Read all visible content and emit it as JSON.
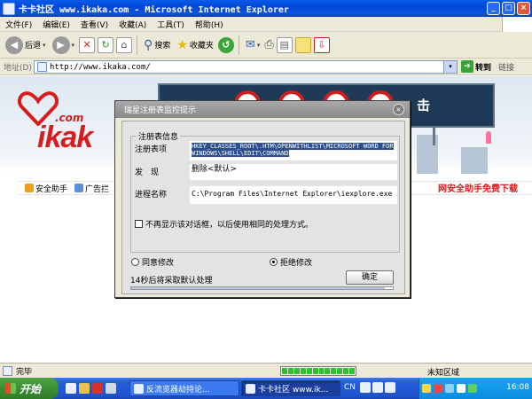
{
  "window": {
    "title": "卡卡社区 www.ikaka.com - Microsoft Internet Explorer"
  },
  "menu": [
    "文件(F)",
    "编辑(E)",
    "查看(V)",
    "收藏(A)",
    "工具(T)",
    "帮助(H)"
  ],
  "toolbar": {
    "back_label": "后退",
    "search_label": "搜索",
    "favorites_label": "收藏夹"
  },
  "address": {
    "label": "地址(D)",
    "url": "http://www.ikaka.com/",
    "go_label": "转到",
    "links_label": "链接"
  },
  "page": {
    "logo_text": "ikak",
    "logo_suffix": ".com",
    "billboard_text": "击",
    "nav": [
      "安全助手",
      "广告拦"
    ],
    "promo_text": "网安全助手免费下载"
  },
  "dialog": {
    "title": "瑞星注册表监控提示",
    "group_title": "注册表信息",
    "fields": [
      {
        "label": "注册表项",
        "value": "HKEY_CLASSES_ROOT\\.HTM\\OPENWITHLIST\\MICROSOFT WORD FOR WINDOWS\\SHELL\\EDIT\\COMMAND"
      },
      {
        "label": "发　现",
        "value": "删除<默认>"
      },
      {
        "label": "进程名称",
        "value": "C:\\Program Files\\Internet Explorer\\iexplore.exe"
      }
    ],
    "checkbox_label": "不再显示该对话框，以后使用相同的处理方式。",
    "radio_agree": "同意修改",
    "radio_reject": "拒绝修改",
    "countdown": "14秒后将采取默认处理",
    "ok_label": "确定",
    "progress": 0.97
  },
  "status": {
    "text": "完毕",
    "zone": "未知区域"
  },
  "taskbar": {
    "start": "开始",
    "tasks": [
      "反流览器劫持论...",
      "卡卡社区 www.ik..."
    ],
    "cn": "CN",
    "clock": "16:08"
  }
}
